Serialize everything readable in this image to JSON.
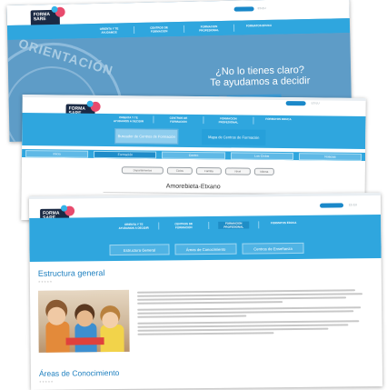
{
  "window1": {
    "logo_text": "FORMA\nSARE",
    "nav": [
      "ORIENTA Y TE AYUDAMOS",
      "CENTROS DE FORMACION",
      "FORMACION PROFESIONAL",
      "FORMATOS EDUCA"
    ],
    "hero_watermark": "ORIENTACIÓN",
    "hero_title": "¿No lo tienes claro?",
    "hero_subtitle": "Te ayudamos a decidir",
    "lang": "ES  EU"
  },
  "window2": {
    "logo_text": "FORMA\nSARE",
    "nav": [
      "ORIENTA Y TE AYUDAMOS A DECIDIR",
      "CENTROS DE FORMACION",
      "FORMACION PROFESIONAL",
      "FORMATOS EDUCA"
    ],
    "block_buttons": [
      "Buscador de Centros de Formación",
      "Mapa de Centros de Formación"
    ],
    "tabs": [
      "Inicio",
      "Formación",
      "Centro",
      "Los Ciclos",
      "Noticias"
    ],
    "active_tab": 1,
    "chips": [
      "Departamentos",
      "Ciclos",
      "Familia",
      "Nivel",
      "Idioma"
    ],
    "place": "Amorebieta-Etxano",
    "lang": "ES  EU"
  },
  "window3": {
    "logo_text": "FORMA\nSARE",
    "nav": [
      "ORIENTA Y TE AYUDAMOS A DECIDIR",
      "CENTROS DE FORMACION",
      "FORMACION PROFESIONAL",
      "FORMATOS EDUCA"
    ],
    "subnav": [
      "Estructura General",
      "Áreas de Conocimiento",
      "Centros de Enseñanza"
    ],
    "section_title": "Estructura general",
    "section2_title": "Áreas de Conocimiento",
    "stars": "★★★★★",
    "lang": "ES  EU"
  },
  "colors": {
    "brand_blue": "#2fa6de",
    "accent_pink": "#e84b6d",
    "title_blue": "#1d7fbf"
  }
}
